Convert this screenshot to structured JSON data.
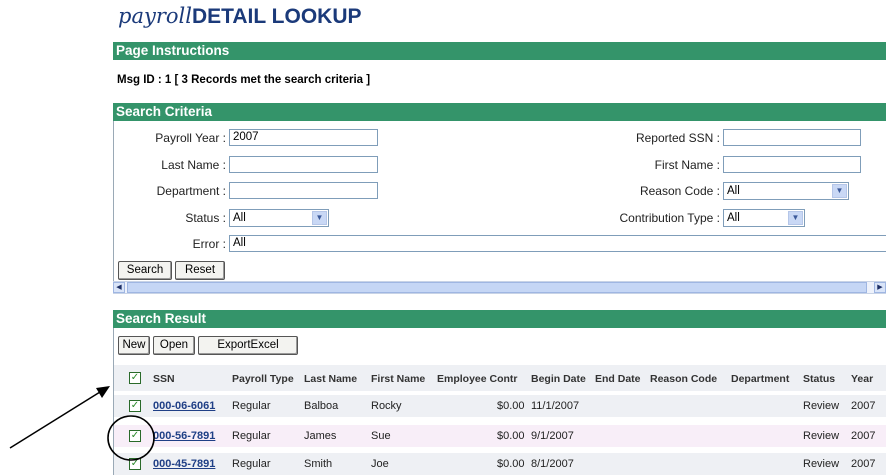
{
  "title": {
    "prefix": "payroll",
    "main": "DETAIL LOOKUP"
  },
  "sections": {
    "instructions": "Page Instructions",
    "criteria": "Search Criteria",
    "result": "Search Result"
  },
  "message": "Msg ID : 1 [ 3 Records met the search criteria ]",
  "form": {
    "payroll_year": {
      "label": "Payroll Year :",
      "value": "2007"
    },
    "last_name": {
      "label": "Last Name :",
      "value": ""
    },
    "department": {
      "label": "Department :",
      "value": ""
    },
    "status": {
      "label": "Status :",
      "value": "All"
    },
    "error": {
      "label": "Error :",
      "value": "All"
    },
    "reported_ssn": {
      "label": "Reported SSN :",
      "value": ""
    },
    "first_name": {
      "label": "First Name :",
      "value": ""
    },
    "reason_code": {
      "label": "Reason Code :",
      "value": "All"
    },
    "contribution_type": {
      "label": "Contribution Type :",
      "value": "All"
    }
  },
  "buttons": {
    "search": "Search",
    "reset": "Reset",
    "new": "New",
    "open": "Open",
    "export": "ExportExcel"
  },
  "columns": [
    "SSN",
    "Payroll Type",
    "Last Name",
    "First Name",
    "Employee Contr",
    "Begin Date",
    "End Date",
    "Reason Code",
    "Department",
    "Status",
    "Year"
  ],
  "rows": [
    {
      "checked": true,
      "ssn": "000-06-6061",
      "payroll_type": "Regular",
      "last_name": "Balboa",
      "first_name": "Rocky",
      "employee_contr": "$0.00",
      "begin_date": "11/1/2007",
      "end_date": "",
      "reason_code": "",
      "department": "",
      "status": "Review",
      "year": "2007"
    },
    {
      "checked": true,
      "ssn": "000-56-7891",
      "payroll_type": "Regular",
      "last_name": "James",
      "first_name": "Sue",
      "employee_contr": "$0.00",
      "begin_date": "9/1/2007",
      "end_date": "",
      "reason_code": "",
      "department": "",
      "status": "Review",
      "year": "2007"
    },
    {
      "checked": true,
      "ssn": "000-45-7891",
      "payroll_type": "Regular",
      "last_name": "Smith",
      "first_name": "Joe",
      "employee_contr": "$0.00",
      "begin_date": "8/1/2007",
      "end_date": "",
      "reason_code": "",
      "department": "",
      "status": "Review",
      "year": "2007"
    }
  ],
  "colors": {
    "section_bar": "#34946a",
    "row_alt": "#f8eef8",
    "row": "#eef0f4",
    "link": "#1f3f86"
  },
  "icons": {
    "checkbox": "checkmark-icon",
    "dropdown": "chevron-down-icon",
    "annotation": "arrow-annotation"
  }
}
